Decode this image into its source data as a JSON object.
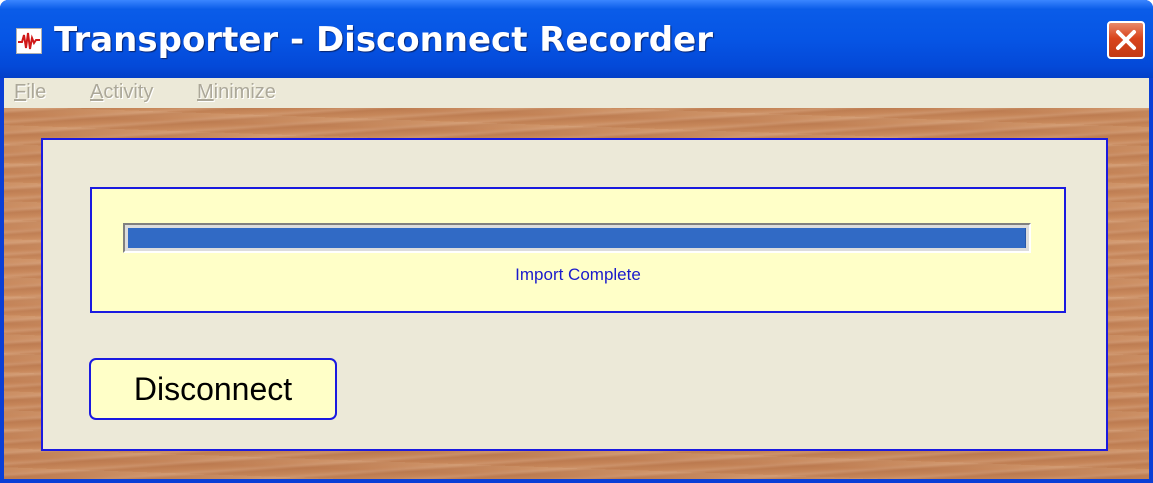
{
  "window": {
    "title": "Transporter - Disconnect Recorder",
    "icon": "waveform-icon",
    "close_icon": "close-icon"
  },
  "menubar": {
    "items": [
      {
        "label": "File",
        "accel": "F",
        "rest": "ile"
      },
      {
        "label": "Activity",
        "accel": "A",
        "rest": "ctivity"
      },
      {
        "label": "Minimize",
        "accel": "M",
        "rest": "inimize"
      }
    ]
  },
  "status": {
    "progress_percent": 100,
    "message": "Import Complete"
  },
  "actions": {
    "disconnect_label": "Disconnect"
  },
  "colors": {
    "title_bar": "#0655E5",
    "panel_border": "#1A1AE0",
    "status_bg": "#FFFFC8",
    "progress_fill": "#316AC5",
    "status_text": "#1A1ACC"
  }
}
